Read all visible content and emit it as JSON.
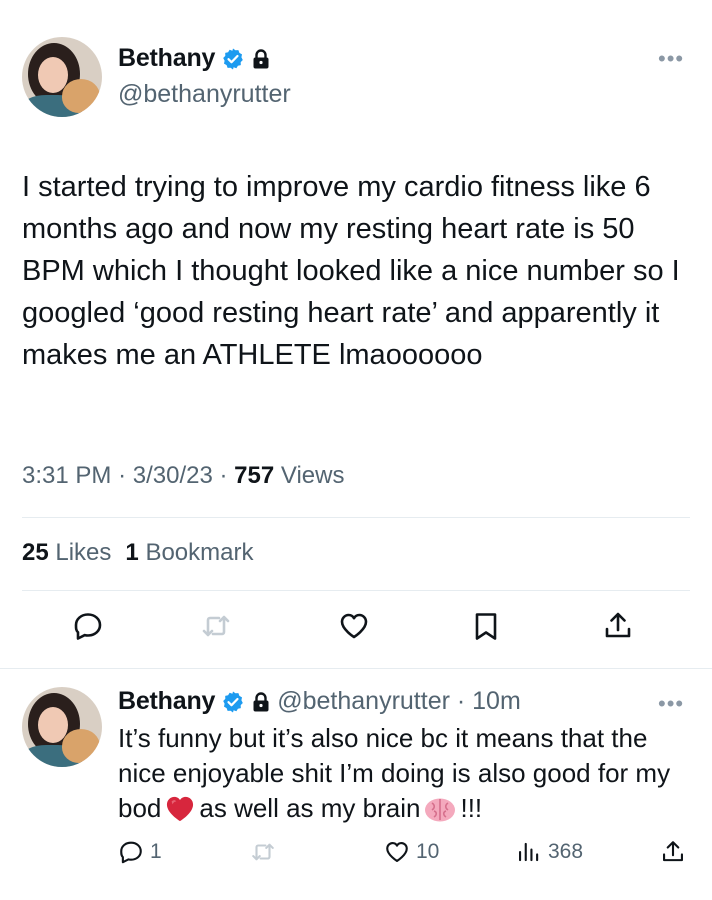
{
  "main_tweet": {
    "author": {
      "display_name": "Bethany",
      "handle": "@bethanyrutter",
      "verified_icon": "verified-badge-icon",
      "protected_icon": "lock-icon"
    },
    "text": "I started trying to improve my cardio fitness like 6 months ago and now my resting heart rate is 50 BPM which I thought looked like a nice number so I googled ‘good resting heart rate’ and apparently it makes me an ATHLETE lmaoooooo",
    "time": "3:31 PM",
    "date": "3/30/23",
    "views_count": "757",
    "views_label": "Views",
    "likes_count": "25",
    "likes_label": "Likes",
    "bookmarks_count": "1",
    "bookmarks_label": "Bookmark",
    "actions": [
      "reply-icon",
      "retweet-icon",
      "like-icon",
      "bookmark-icon",
      "share-icon"
    ]
  },
  "reply_tweet": {
    "author": {
      "display_name": "Bethany",
      "handle": "@bethanyrutter",
      "time_ago": "10m"
    },
    "text_part1": "It’s funny but it’s also nice bc it means that the nice enjoyable shit I’m doing is also good for my bod",
    "text_part2": "as well as my brain",
    "text_part3": "!!!",
    "emoji_1": "red-heart-emoji",
    "emoji_2": "brain-emoji",
    "replies": "1",
    "retweets": "",
    "likes": "10",
    "views": "368"
  },
  "colors": {
    "text": "#0f1419",
    "secondary": "#536471",
    "verified": "#1d9bf0",
    "icon": "#0f1419",
    "muted_icon": "#c4ccd3",
    "divider": "#e6ecf0"
  }
}
